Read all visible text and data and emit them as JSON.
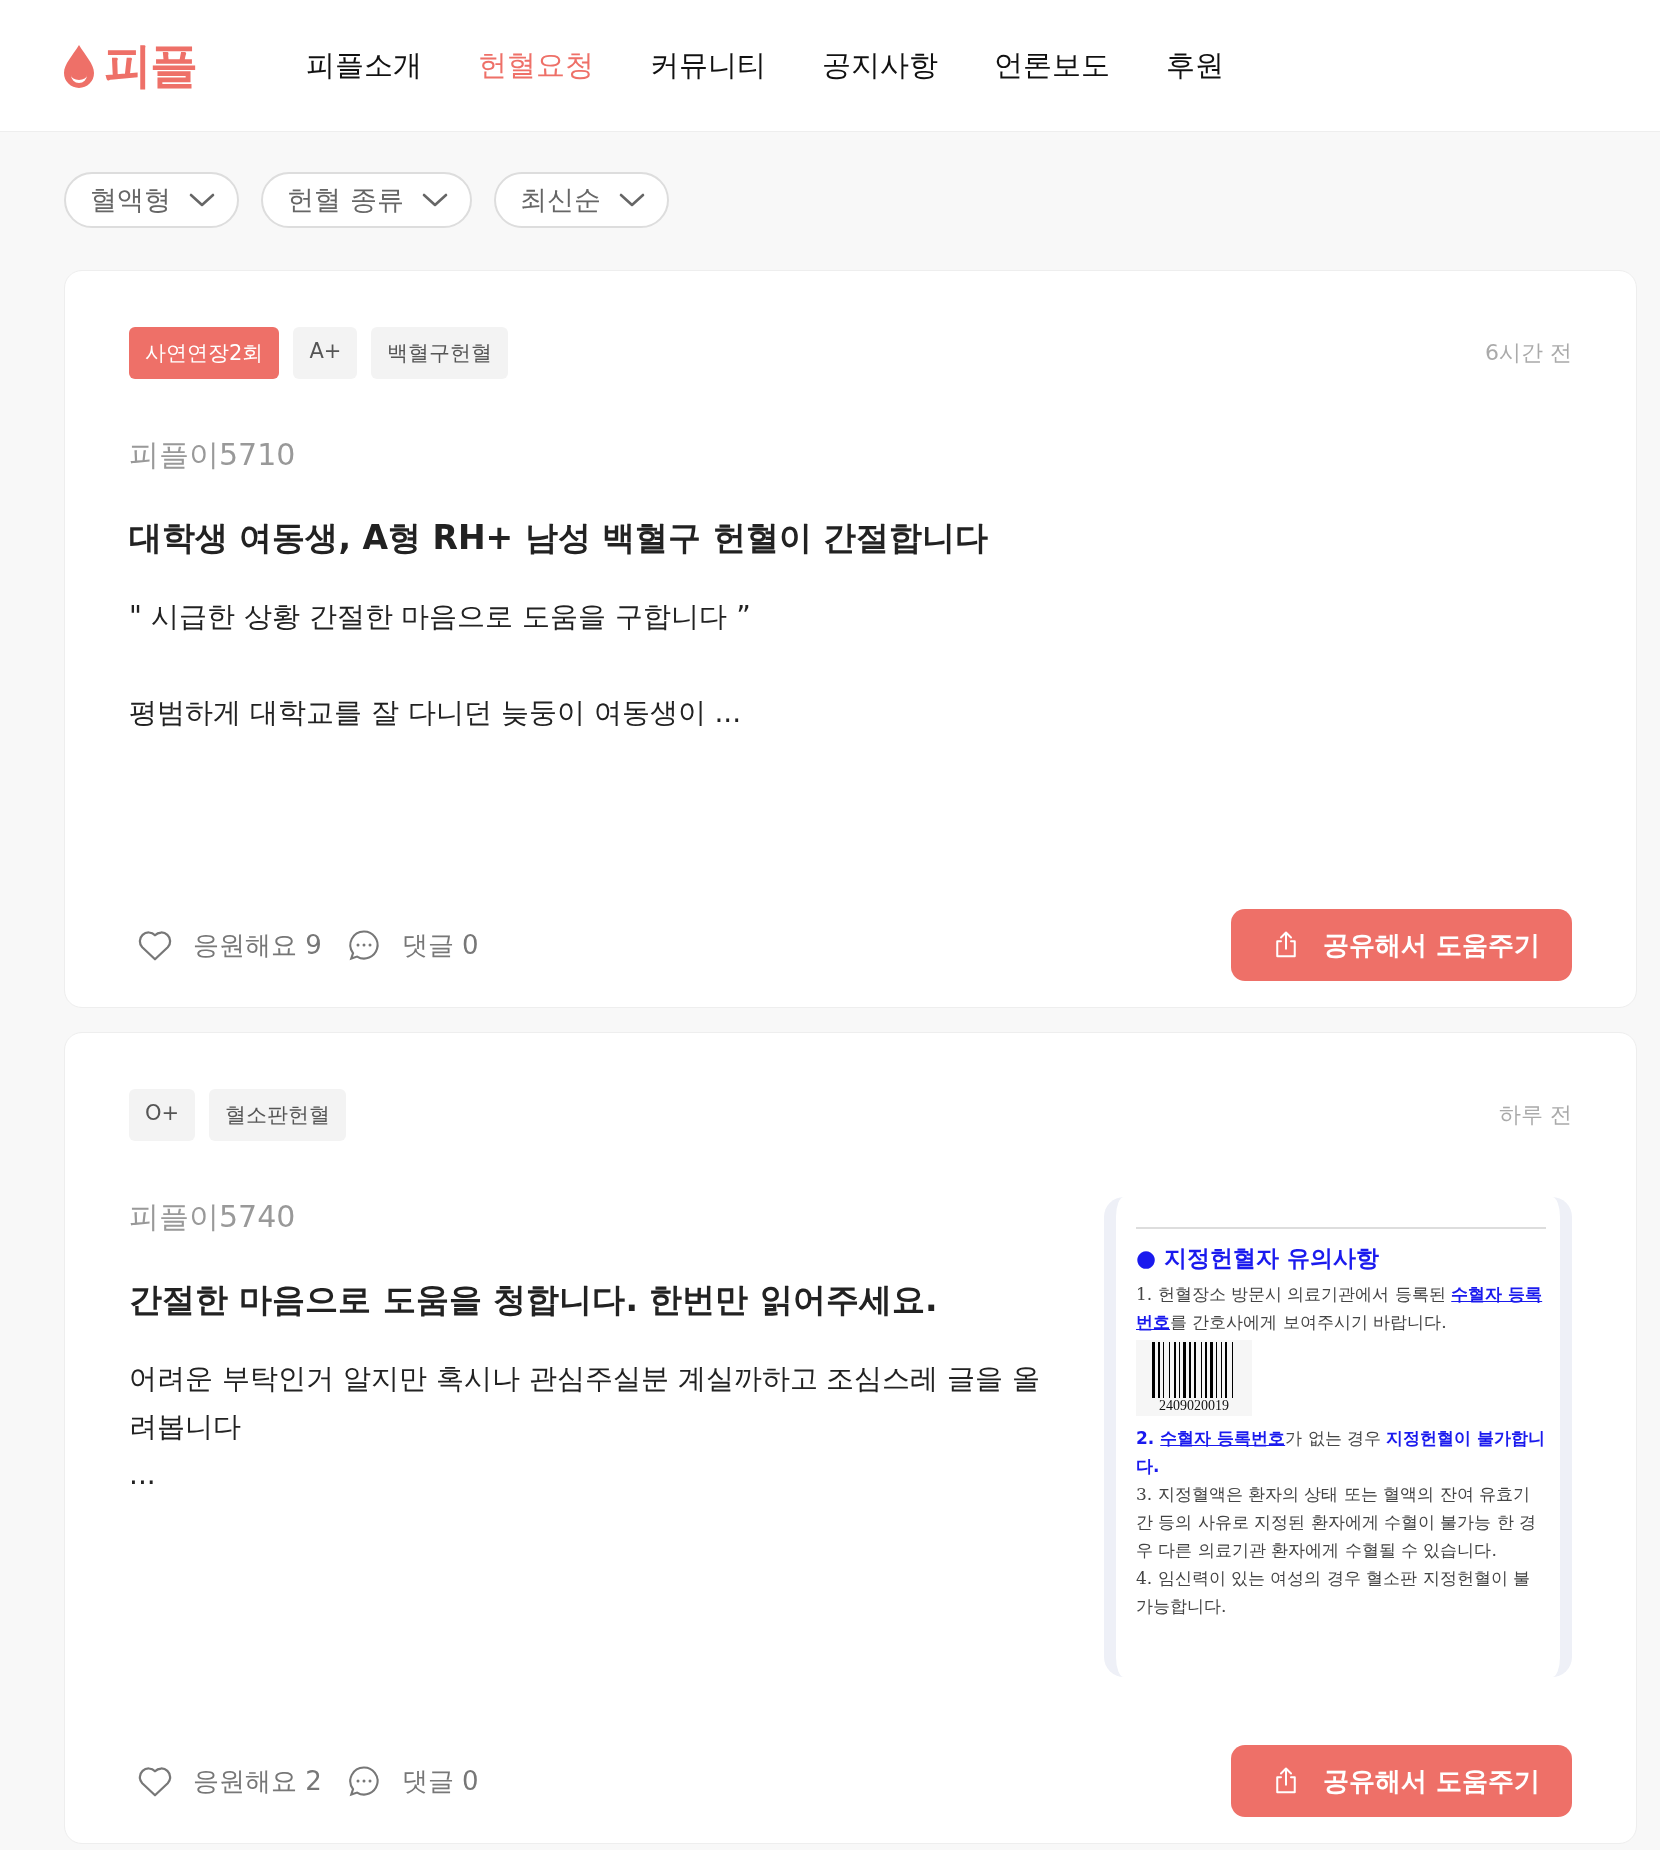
{
  "header": {
    "logo": "피플",
    "nav": [
      {
        "label": "피플소개",
        "selected": false
      },
      {
        "label": "헌혈요청",
        "selected": true
      },
      {
        "label": "커뮤니티",
        "selected": false
      },
      {
        "label": "공지사항",
        "selected": false
      },
      {
        "label": "언론보도",
        "selected": false
      },
      {
        "label": "후원",
        "selected": false
      }
    ]
  },
  "filters": [
    {
      "label": "혈액형"
    },
    {
      "label": "헌혈 종류"
    },
    {
      "label": "최신순"
    }
  ],
  "posts": [
    {
      "tags": [
        {
          "label": "사연연장2회",
          "kind": "accent"
        },
        {
          "label": "A+",
          "kind": "plain"
        },
        {
          "label": "백혈구헌혈",
          "kind": "plain"
        }
      ],
      "time": "6시간 전",
      "author": "피플이5710",
      "title": "대학생 여동생, A형 RH+ 남성 백혈구 헌혈이 간절합니다",
      "excerpt": [
        [
          "\" 시급한 상황 간절한 마음으로 도움을 구합니다 ”"
        ],
        [
          "평범하게 대학교를 잘 다니던 늦둥이 여동생이 ..."
        ]
      ],
      "cheer": "응원해요 9",
      "comments": "댓글 0",
      "share": "공유해서 도움주기"
    },
    {
      "tags": [
        {
          "label": "O+",
          "kind": "plain"
        },
        {
          "label": "혈소판헌혈",
          "kind": "plain"
        }
      ],
      "time": "하루 전",
      "author": "피플이5740",
      "title": "간절한 마음으로 도움을 청합니다. 한번만 읽어주세요.",
      "excerpt": [
        [
          "어려운 부탁인거 알지만 혹시나 관심주실분 계실까하고 조심스레 글을 올려봅니다",
          "..."
        ]
      ],
      "cheer": "응원해요 2",
      "comments": "댓글 0",
      "share": "공유해서 도움주기",
      "attachment": {
        "heading": "● 지정헌혈자 유의사항",
        "items": [
          [
            {
              "text": "1. 헌혈장소 방문시 의료기관에서 등록된 ",
              "kind": "plain"
            },
            {
              "text": "수혈자 등록번호",
              "kind": "link"
            },
            {
              "text": "를 간호사에게 보여주시기 바랍니다.",
              "kind": "plain"
            }
          ],
          [
            {
              "text": "2. ",
              "kind": "strong"
            },
            {
              "text": "수혈자 등록번호",
              "kind": "link"
            },
            {
              "text": "가 없는 경우 ",
              "kind": "plain"
            },
            {
              "text": "지정헌혈이 불가합니다.",
              "kind": "strong"
            }
          ],
          [
            {
              "text": "3. 지정혈액은 환자의 상태 또는 혈액의 잔여 유효기간 등의 사유로 지정된 환자에게 수혈이 불가능 한 경우 다른 의료기관 환자에게 수혈될 수 있습니다.",
              "kind": "plain"
            }
          ],
          [
            {
              "text": "4. 임신력이 있는 여성의 경우 혈소판 지정헌혈이 불가능합니다.",
              "kind": "plain"
            }
          ]
        ],
        "barcode": "2409020019"
      }
    }
  ]
}
